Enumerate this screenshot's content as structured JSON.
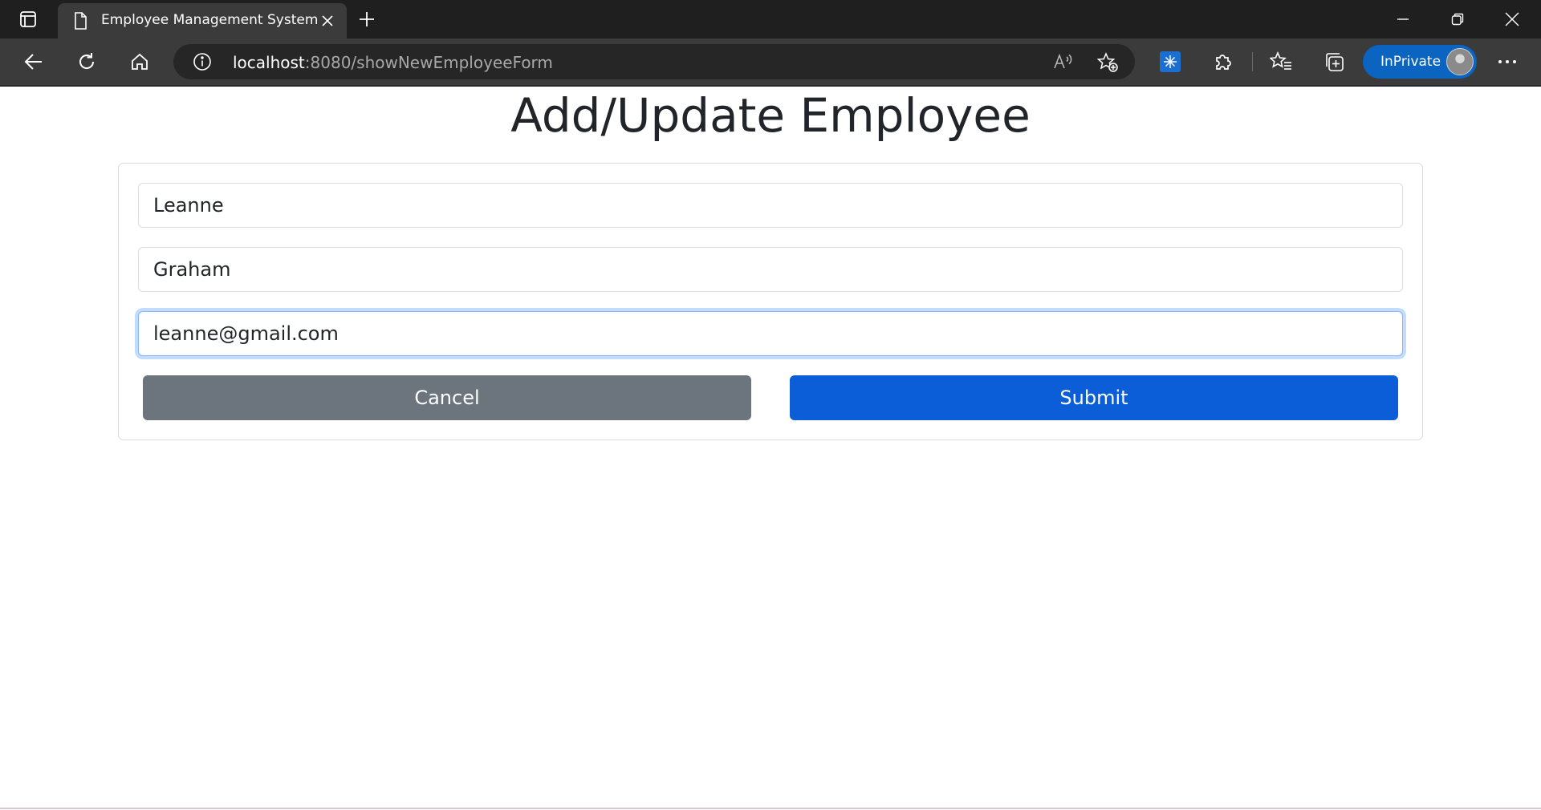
{
  "browser": {
    "tab": {
      "title": "Employee Management System"
    },
    "address": {
      "host": "localhost",
      "path": ":8080/showNewEmployeeForm"
    },
    "profile": {
      "label": "InPrivate"
    },
    "icons": [
      "tab-actions-icon",
      "page-icon",
      "close-icon",
      "plus-icon",
      "minimize-icon",
      "restore-icon",
      "close-window-icon",
      "back-arrow-icon",
      "refresh-icon",
      "home-icon",
      "info-icon",
      "read-aloud-icon",
      "add-favorite-icon",
      "extension-snowflake-icon",
      "extensions-puzzle-icon",
      "favorites-icon",
      "collections-icon",
      "more-icon"
    ],
    "accent_color": "#0a64c0"
  },
  "page": {
    "title": "Add/Update Employee",
    "form": {
      "first_name": "Leanne",
      "last_name": "Graham",
      "email": "leanne@gmail.com"
    },
    "buttons": {
      "cancel": "Cancel",
      "submit": "Submit"
    },
    "colors": {
      "cancel": "#6c757d",
      "submit": "#0b5ed7",
      "focus_ring": "#86b7fe"
    }
  }
}
